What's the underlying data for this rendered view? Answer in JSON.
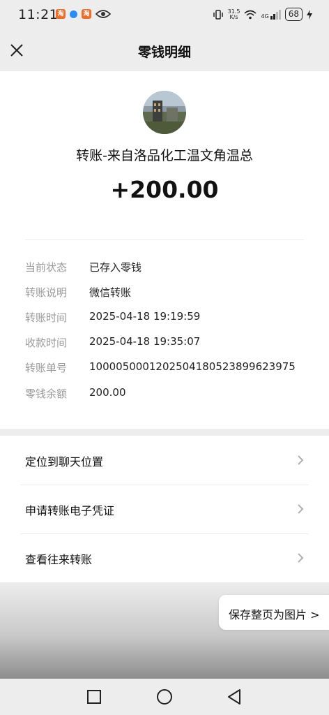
{
  "status_bar": {
    "time": "11:21",
    "net_speed_value": "31.5",
    "net_speed_unit": "K/s",
    "network_type": "4G",
    "battery": "68"
  },
  "header": {
    "title": "零钱明细",
    "close_icon": "close-icon"
  },
  "transfer": {
    "payer_text": "转账-来自洛品化工温文角温总",
    "amount": "+200.00"
  },
  "details": [
    {
      "label": "当前状态",
      "value": "已存入零钱"
    },
    {
      "label": "转账说明",
      "value": "微信转账"
    },
    {
      "label": "转账时间",
      "value": "2025-04-18 19:19:59"
    },
    {
      "label": "收款时间",
      "value": "2025-04-18 19:35:07"
    },
    {
      "label": "转账单号",
      "value": "1000050001202504180523899623975"
    },
    {
      "label": "零钱余额",
      "value": "200.00"
    }
  ],
  "actions": [
    {
      "label": "定位到聊天位置"
    },
    {
      "label": "申请转账电子凭证"
    },
    {
      "label": "查看往来转账"
    }
  ],
  "save_button": {
    "label": "保存整页为图片 >"
  },
  "nav": {
    "recents_icon": "square-icon",
    "home_icon": "circle-icon",
    "back_icon": "triangle-back-icon"
  },
  "colors": {
    "background": "#ededed",
    "card": "#ffffff",
    "label_gray": "#9a9a9a",
    "text": "#111111"
  }
}
